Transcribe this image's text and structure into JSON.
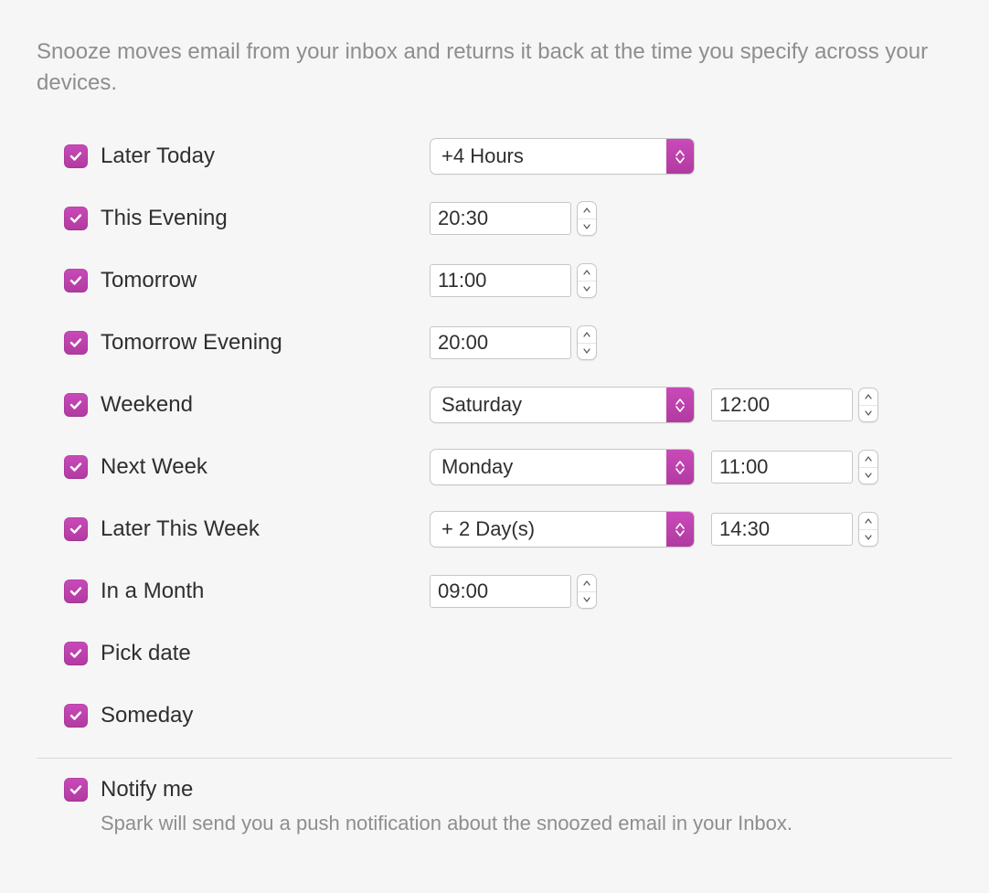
{
  "description": "Snooze moves email from your inbox and returns it back at the time you specify across your devices.",
  "options": {
    "later_today": {
      "label": "Later Today",
      "select": "+4 Hours"
    },
    "this_evening": {
      "label": "This Evening",
      "time": "20:30"
    },
    "tomorrow": {
      "label": "Tomorrow",
      "time": "11:00"
    },
    "tomorrow_evening": {
      "label": "Tomorrow Evening",
      "time": "20:00"
    },
    "weekend": {
      "label": "Weekend",
      "select": "Saturday",
      "time": "12:00"
    },
    "next_week": {
      "label": "Next Week",
      "select": "Monday",
      "time": "11:00"
    },
    "later_this_week": {
      "label": "Later This Week",
      "select": "+ 2 Day(s)",
      "time": "14:30"
    },
    "in_a_month": {
      "label": "In a Month",
      "time": "09:00"
    },
    "pick_date": {
      "label": "Pick date"
    },
    "someday": {
      "label": "Someday"
    }
  },
  "notify": {
    "label": "Notify me",
    "description": "Spark will send you a push notification about the snoozed email in your Inbox."
  }
}
